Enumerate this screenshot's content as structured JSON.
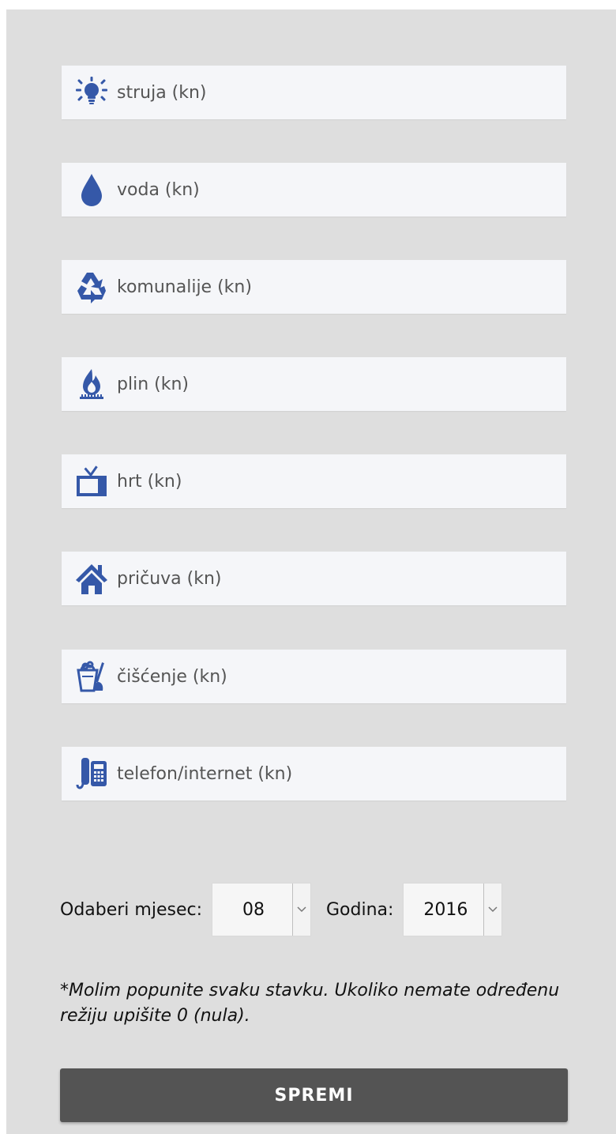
{
  "accent_color": "#3558a8",
  "fields": [
    {
      "icon": "lightbulb-icon",
      "placeholder": "struja (kn)",
      "value": ""
    },
    {
      "icon": "water-drop-icon",
      "placeholder": "voda (kn)",
      "value": ""
    },
    {
      "icon": "recycle-icon",
      "placeholder": "komunalije (kn)",
      "value": ""
    },
    {
      "icon": "gas-flame-icon",
      "placeholder": "plin (kn)",
      "value": ""
    },
    {
      "icon": "tv-icon",
      "placeholder": "hrt (kn)",
      "value": ""
    },
    {
      "icon": "house-icon",
      "placeholder": "pričuva (kn)",
      "value": ""
    },
    {
      "icon": "cleaning-bucket-icon",
      "placeholder": "čišćenje (kn)",
      "value": ""
    },
    {
      "icon": "phone-icon",
      "placeholder": "telefon/internet (kn)",
      "value": ""
    }
  ],
  "month_select": {
    "label": "Odaberi mjesec:",
    "value": "08"
  },
  "year_select": {
    "label": "Godina:",
    "value": "2016"
  },
  "note": "*Molim popunite svaku stavku. Ukoliko nemate određenu režiju upišite 0 (nula).",
  "save_button": {
    "label": "SPREMI"
  }
}
